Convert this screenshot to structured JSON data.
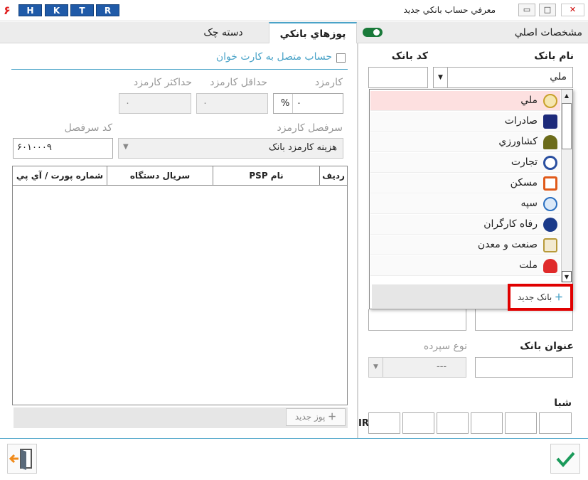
{
  "titlebar": {
    "logo": "۶",
    "hotkeys": [
      "H",
      "K",
      "T",
      "R"
    ],
    "title": "معرفي حساب بانکي جديد",
    "min": "▭",
    "restore": "□",
    "close": "✕"
  },
  "tabs": {
    "pos": "پوزهاي بانکي",
    "cheque": "دسته چک",
    "main_settings": "مشخصات اصلي"
  },
  "left": {
    "card_reader_label": "حساب متصل به کارت خوان",
    "fee_label": "کارمزد",
    "fee_value": "۰",
    "fee_unit": "%",
    "min_fee_label": "حداقل کارمزد",
    "min_fee_value": "۰",
    "max_fee_label": "حداکثر کارمزد",
    "max_fee_value": "۰",
    "fee_header_label": "سرفصل کارمزد",
    "fee_header_value": "هزينه کارمزد بانک",
    "header_code_label": "کد سرفصل",
    "header_code_value": "۶۰۱۰۰۰۹",
    "grid_headers": [
      "رديف",
      "نام PSP",
      "سريال دستگاه",
      "شماره پورت / آي پي"
    ],
    "new_pos": "پوز جديد"
  },
  "right": {
    "bank_name_label": "نام بانک",
    "bank_code_label": "کد بانک",
    "bank_selected": "ملي",
    "banks": [
      {
        "name": "ملي",
        "color": "#c8a02a",
        "selected": true
      },
      {
        "name": "صادرات",
        "color": "#1c2a7a"
      },
      {
        "name": "کشاورزي",
        "color": "#6b6b1a"
      },
      {
        "name": "تجارت",
        "color": "#2a4fa0"
      },
      {
        "name": "مسکن",
        "color": "#e05a1a"
      },
      {
        "name": "سپه",
        "color": "#2a6fc0"
      },
      {
        "name": "رفاه کارگران",
        "color": "#1a3a8a"
      },
      {
        "name": "صنعت و معدن",
        "color": "#b89a3a"
      },
      {
        "name": "ملت",
        "color": "#e02a2a"
      }
    ],
    "new_bank": "بانک جديد",
    "bank_title_label": "عنوان بانک",
    "deposit_type_label": "نوع سپرده",
    "deposit_type_value": "---",
    "iban_label": "شبا",
    "iban_prefix": "IR"
  }
}
